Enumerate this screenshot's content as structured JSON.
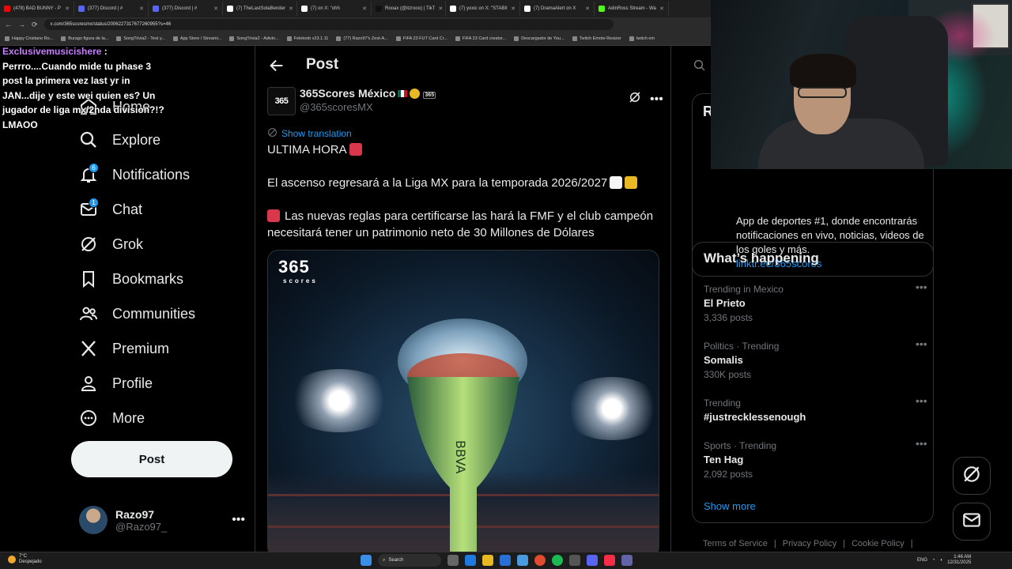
{
  "browser": {
    "tabs": [
      {
        "label": "(478) BAD BUNNY - P",
        "color": "#ff0000"
      },
      {
        "label": "(377) Discord | #",
        "color": "#5865f2"
      },
      {
        "label": "(377) Discord | #",
        "color": "#5865f2"
      },
      {
        "label": "(7) TheLastSolaBender",
        "color": "#ffffff"
      },
      {
        "label": "(7) on X: \"ohh",
        "color": "#ffffff"
      },
      {
        "label": "Rooax (@itzrooo) | TikT",
        "color": "#111111"
      },
      {
        "label": "(7) yoxic on X: \"STABII",
        "color": "#ffffff"
      },
      {
        "label": "(7) DramaAlert on X",
        "color": "#ffffff"
      },
      {
        "label": "AdinRoss Stream - Wa",
        "color": "#53fc18"
      }
    ],
    "url": "x.com/365scoresmx/status/2006227317677260955?s=46",
    "bookmarks": [
      "Happy Cristiano Ro...",
      "Burago figura de la...",
      "SongTrivia2 - Test y...",
      "App Store / Streami...",
      "SongTrivia2 - Adivin...",
      "Feletoob v23.1.11",
      "(77) Razo97's Zest-A...",
      "FIFA 23 FUT Card Cr...",
      "FIFA 23 Card creator...",
      "Descargador de You...",
      "Twitch Emote Resizer",
      "twitch em"
    ]
  },
  "chat_overlay": {
    "username": "Exclusivemusicishere",
    "colon": ":",
    "lines": [
      "Perrro....Cuando mide tu phase 3",
      "post la primera vez last yr in",
      "JAN...dije y este wei quien es? Un",
      "jugador de liga mx/2nda division?!?",
      "LMAOO"
    ]
  },
  "nav": {
    "items": [
      {
        "label": "Home",
        "icon": "home-icon"
      },
      {
        "label": "Explore",
        "icon": "search-icon"
      },
      {
        "label": "Notifications",
        "icon": "bell-icon",
        "badge": "6"
      },
      {
        "label": "Chat",
        "icon": "mail-icon",
        "badge": "1"
      },
      {
        "label": "Grok",
        "icon": "grok-icon"
      },
      {
        "label": "Bookmarks",
        "icon": "bookmark-icon"
      },
      {
        "label": "Communities",
        "icon": "people-icon"
      },
      {
        "label": "Premium",
        "icon": "x-logo-icon"
      },
      {
        "label": "Profile",
        "icon": "person-icon"
      },
      {
        "label": "More",
        "icon": "more-circle-icon"
      }
    ],
    "post_button": "Post",
    "account": {
      "name": "Razo97",
      "handle": "@Razo97_",
      "more": "•••"
    }
  },
  "main": {
    "header_title": "Post",
    "author": {
      "name": "365Scores México",
      "handle": "@365scoresMX",
      "avatar_text": "365"
    },
    "show_translation": "Show translation",
    "text": {
      "line1": "ULTIMA HORA",
      "line2": "El ascenso regresará a la Liga MX para la temporada 2026/2027",
      "line3": "Las nuevas reglas para certificarse las hará la FMF y el club campeón necesitará tener un patrimonio neto de 30 Millones de Dólares"
    },
    "media": {
      "logo": "365",
      "logo_sub": "scores",
      "trophy_text": "BBVA"
    }
  },
  "right": {
    "profile_card": {
      "initial": "R",
      "bio": "App de deportes #1, donde encontrarás notificaciones en vivo, noticias, videos de los goles y más.",
      "link": "linktr.ee/365scores"
    },
    "whats_happening": {
      "title": "What’s happening",
      "trends": [
        {
          "category": "Trending in Mexico",
          "name": "El Prieto",
          "count": "3,336 posts"
        },
        {
          "category": "Politics · Trending",
          "name": "Somalis",
          "count": "330K posts"
        },
        {
          "category": "Trending",
          "name": "#justrecklessenough",
          "count": ""
        },
        {
          "category": "Sports · Trending",
          "name": "Ten Hag",
          "count": "2,092 posts"
        }
      ],
      "show_more": "Show more"
    },
    "footer": [
      "Terms of Service",
      "|",
      "Privacy Policy",
      "|",
      "Cookie Policy",
      "|"
    ]
  },
  "taskbar": {
    "temp": "7°C",
    "weather": "Despejado",
    "search": "Search",
    "lang": "ENG",
    "time": "1:46 AM",
    "date": "12/31/2025"
  },
  "colors": {
    "accent": "#1d9bf0",
    "background": "#000000",
    "border": "#2f3336",
    "muted": "#71767b",
    "chat_user": "#c77dff"
  }
}
